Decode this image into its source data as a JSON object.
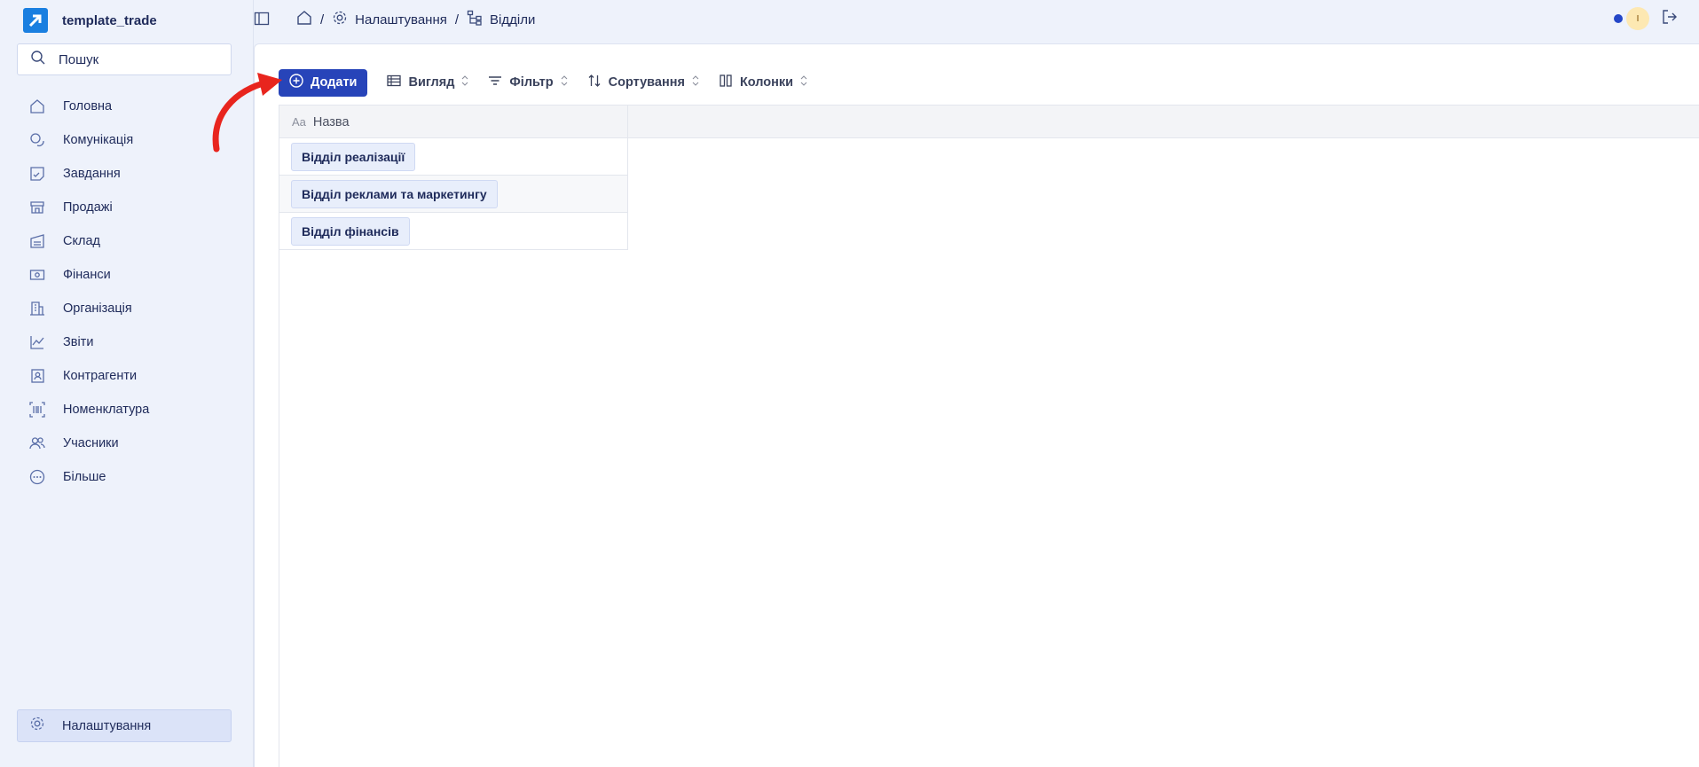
{
  "brand": {
    "name": "template_trade",
    "logo_color": "#1a7fe0"
  },
  "search": {
    "placeholder": "Пошук"
  },
  "sidebar": {
    "items": [
      {
        "label": "Головна",
        "icon": "home-icon"
      },
      {
        "label": "Комунікація",
        "icon": "chat-icon"
      },
      {
        "label": "Завдання",
        "icon": "task-icon"
      },
      {
        "label": "Продажі",
        "icon": "store-icon"
      },
      {
        "label": "Склад",
        "icon": "warehouse-icon"
      },
      {
        "label": "Фінанси",
        "icon": "money-icon"
      },
      {
        "label": "Організація",
        "icon": "building-icon"
      },
      {
        "label": "Звіти",
        "icon": "chart-icon"
      },
      {
        "label": "Контрагенти",
        "icon": "contact-icon"
      },
      {
        "label": "Номенклатура",
        "icon": "barcode-icon"
      },
      {
        "label": "Учасники",
        "icon": "users-icon"
      },
      {
        "label": "Більше",
        "icon": "more-icon"
      }
    ],
    "settings": {
      "label": "Налаштування",
      "icon": "gear-icon"
    }
  },
  "breadcrumb": {
    "settings": "Налаштування",
    "departments": "Відділи"
  },
  "user": {
    "initial": "І"
  },
  "toolbar": {
    "add": "Додати",
    "view": "Вигляд",
    "filter": "Фільтр",
    "sort": "Сортування",
    "columns": "Колонки"
  },
  "table": {
    "column_prefix": "Aa",
    "column": "Назва",
    "rows": [
      "Відділ реалізації",
      "Відділ реклами та маркетингу",
      "Відділ фінансів"
    ]
  },
  "colors": {
    "accent": "#2744b9",
    "annotation": "#e8251e"
  }
}
